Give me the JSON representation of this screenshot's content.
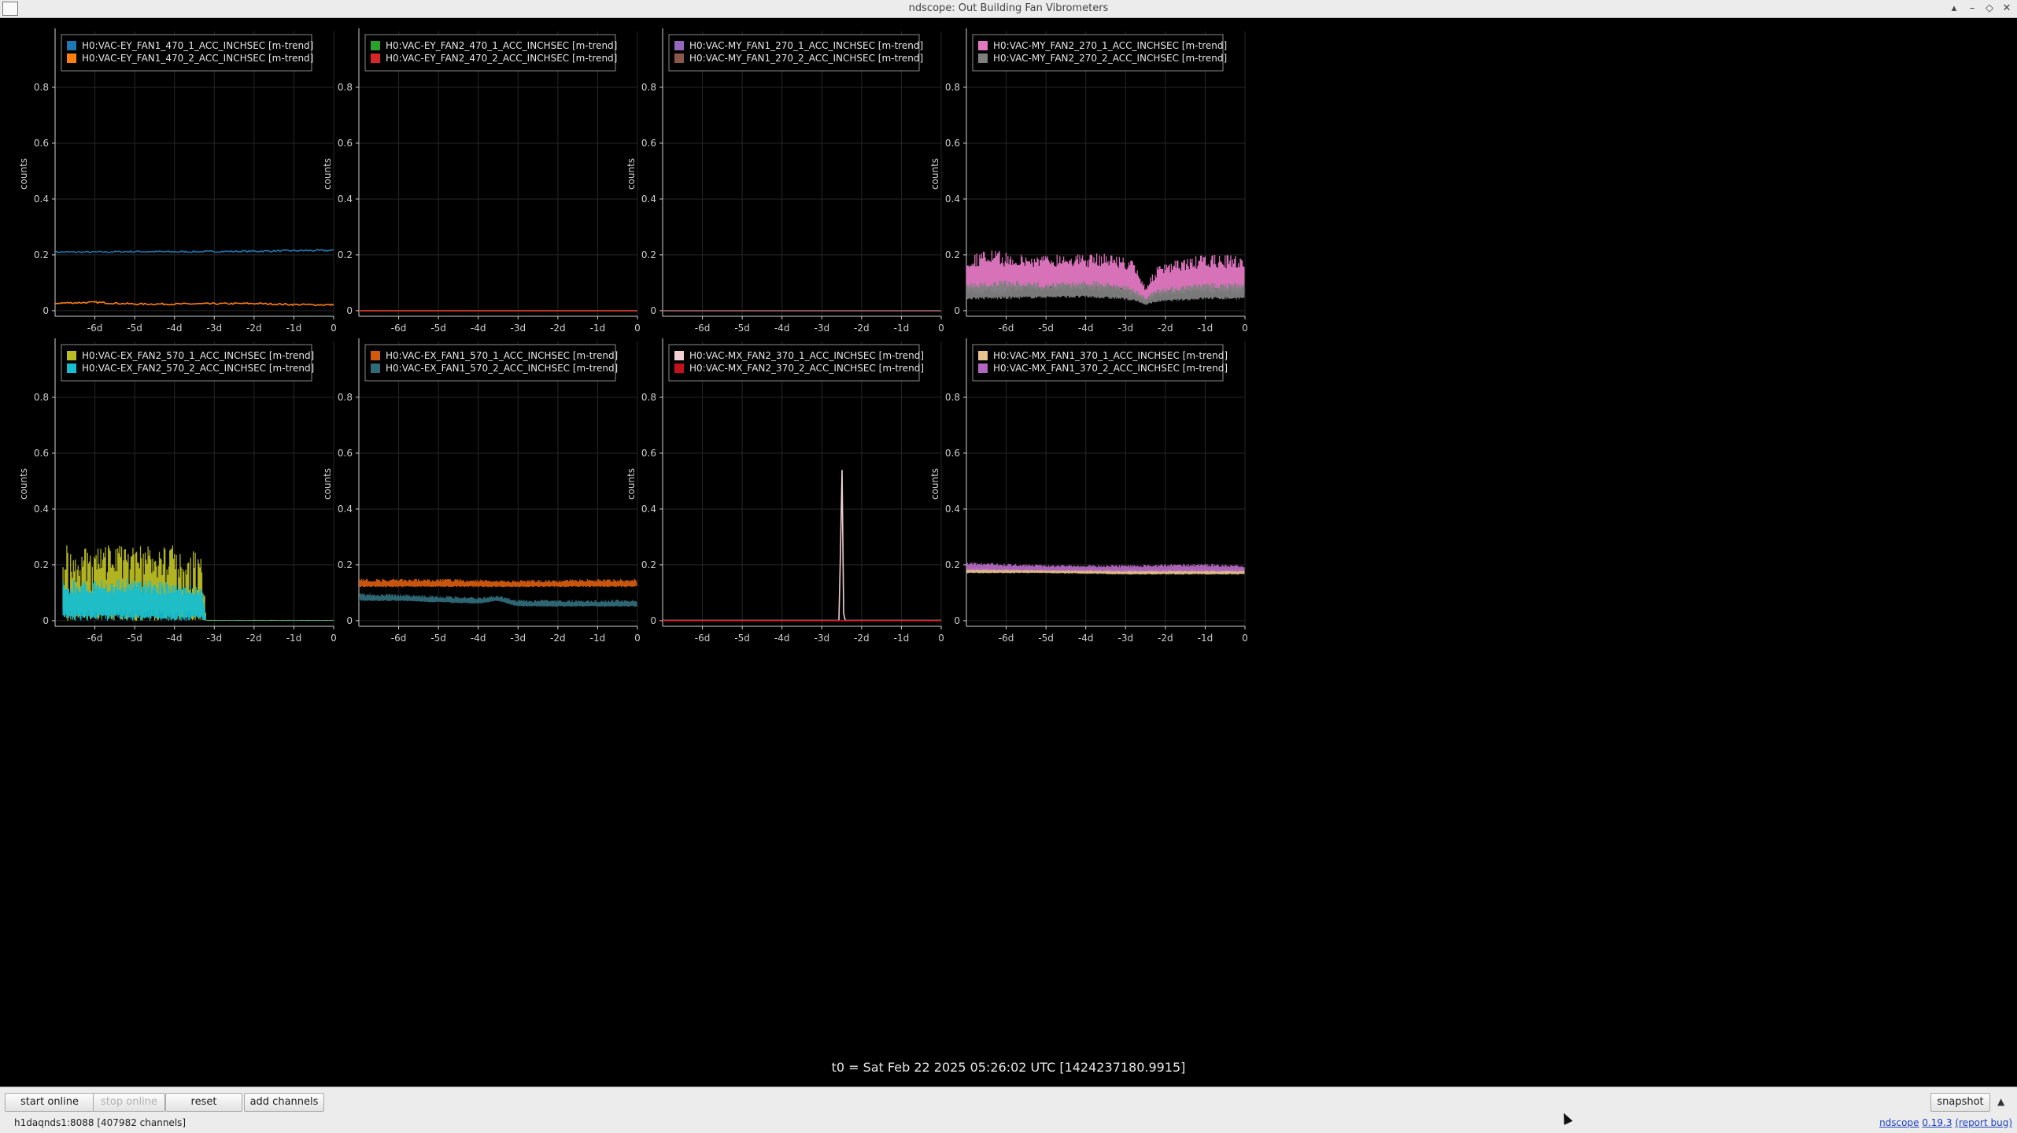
{
  "window": {
    "title": "ndscope: Out Building Fan Vibrometers"
  },
  "colors": {
    "background": "#000000",
    "axis": "#cfcfcf",
    "grid": "#262626",
    "legend_border": "#8a8a8a"
  },
  "plots": [
    {
      "ylabel": "counts",
      "legend": [
        {
          "name": "H0:VAC-EY_FAN1_470_1_ACC_INCHSEC [m-trend]",
          "color": "#1f77b4"
        },
        {
          "name": "H0:VAC-EY_FAN1_470_2_ACC_INCHSEC [m-trend]",
          "color": "#ff7f0e"
        }
      ]
    },
    {
      "ylabel": "counts",
      "legend": [
        {
          "name": "H0:VAC-EY_FAN2_470_1_ACC_INCHSEC [m-trend]",
          "color": "#2ca02c"
        },
        {
          "name": "H0:VAC-EY_FAN2_470_2_ACC_INCHSEC [m-trend]",
          "color": "#d62728"
        }
      ]
    },
    {
      "ylabel": "counts",
      "legend": [
        {
          "name": "H0:VAC-MY_FAN1_270_1_ACC_INCHSEC [m-trend]",
          "color": "#9467bd"
        },
        {
          "name": "H0:VAC-MY_FAN1_270_2_ACC_INCHSEC [m-trend]",
          "color": "#8c564b"
        }
      ]
    },
    {
      "ylabel": "counts",
      "legend": [
        {
          "name": "H0:VAC-MY_FAN2_270_1_ACC_INCHSEC [m-trend]",
          "color": "#e377c2"
        },
        {
          "name": "H0:VAC-MY_FAN2_270_2_ACC_INCHSEC [m-trend]",
          "color": "#7f7f7f"
        }
      ]
    },
    {
      "ylabel": "counts",
      "legend": [
        {
          "name": "H0:VAC-EX_FAN2_570_1_ACC_INCHSEC [m-trend]",
          "color": "#bcbd22"
        },
        {
          "name": "H0:VAC-EX_FAN2_570_2_ACC_INCHSEC [m-trend]",
          "color": "#17becf"
        }
      ]
    },
    {
      "ylabel": "counts",
      "legend": [
        {
          "name": "H0:VAC-EX_FAN1_570_1_ACC_INCHSEC [m-trend]",
          "color": "#d25a0e"
        },
        {
          "name": "H0:VAC-EX_FAN1_570_2_ACC_INCHSEC [m-trend]",
          "color": "#2f6b78"
        }
      ]
    },
    {
      "ylabel": "counts",
      "legend": [
        {
          "name": "H0:VAC-MX_FAN2_370_1_ACC_INCHSEC [m-trend]",
          "color": "#f2d0d4"
        },
        {
          "name": "H0:VAC-MX_FAN2_370_2_ACC_INCHSEC [m-trend]",
          "color": "#c4121a"
        }
      ]
    },
    {
      "ylabel": "counts",
      "legend": [
        {
          "name": "H0:VAC-MX_FAN1_370_1_ACC_INCHSEC [m-trend]",
          "color": "#e8c48c"
        },
        {
          "name": "H0:VAC-MX_FAN1_370_2_ACC_INCHSEC [m-trend]",
          "color": "#b368c0"
        }
      ]
    }
  ],
  "chart_data": [
    {
      "type": "line",
      "ylabel": "counts",
      "xticks": [
        "-6d",
        "-5d",
        "-4d",
        "-3d",
        "-2d",
        "-1d",
        "0"
      ],
      "yticks": [
        "0",
        "0.2",
        "0.4",
        "0.6",
        "0.8"
      ],
      "xlim": [
        -7,
        0
      ],
      "ylim": [
        -0.02,
        1.0
      ],
      "series": [
        {
          "name": "H0:VAC-EY_FAN1_470_1_ACC_INCHSEC [m-trend]",
          "color": "#1f77b4",
          "x": [
            -7,
            -6,
            -5,
            -4,
            -3,
            -2,
            -1,
            0
          ],
          "y": [
            0.21,
            0.21,
            0.212,
            0.211,
            0.212,
            0.213,
            0.215,
            0.216
          ]
        },
        {
          "name": "H0:VAC-EY_FAN1_470_2_ACC_INCHSEC [m-trend]",
          "color": "#ff7f0e",
          "x": [
            -7,
            -6,
            -5,
            -4,
            -3,
            -2,
            -1,
            0
          ],
          "y": [
            0.027,
            0.03,
            0.024,
            0.024,
            0.025,
            0.026,
            0.022,
            0.021
          ]
        }
      ]
    },
    {
      "type": "line",
      "ylabel": "counts",
      "xticks": [
        "-6d",
        "-5d",
        "-4d",
        "-3d",
        "-2d",
        "-1d",
        "0"
      ],
      "yticks": [
        "0",
        "0.2",
        "0.4",
        "0.6",
        "0.8"
      ],
      "xlim": [
        -7,
        0
      ],
      "ylim": [
        -0.02,
        1.0
      ],
      "series": [
        {
          "name": "H0:VAC-EY_FAN2_470_1_ACC_INCHSEC [m-trend]",
          "color": "#2ca02c",
          "x": [
            -7,
            0
          ],
          "y": [
            0,
            0
          ]
        },
        {
          "name": "H0:VAC-EY_FAN2_470_2_ACC_INCHSEC [m-trend]",
          "color": "#d62728",
          "x": [
            -7,
            0
          ],
          "y": [
            0,
            0
          ]
        }
      ]
    },
    {
      "type": "line",
      "ylabel": "counts",
      "xticks": [
        "-6d",
        "-5d",
        "-4d",
        "-3d",
        "-2d",
        "-1d",
        "0"
      ],
      "yticks": [
        "0",
        "0.2",
        "0.4",
        "0.6",
        "0.8"
      ],
      "xlim": [
        -7,
        0
      ],
      "ylim": [
        -0.02,
        1.0
      ],
      "series": [
        {
          "name": "H0:VAC-MY_FAN1_270_1_ACC_INCHSEC [m-trend]",
          "color": "#9467bd",
          "x": [
            -7,
            0
          ],
          "y": [
            0,
            0
          ]
        },
        {
          "name": "H0:VAC-MY_FAN1_270_2_ACC_INCHSEC [m-trend]",
          "color": "#8c564b",
          "x": [
            -7,
            0
          ],
          "y": [
            0,
            0
          ]
        }
      ]
    },
    {
      "type": "area",
      "ylabel": "counts",
      "xticks": [
        "-6d",
        "-5d",
        "-4d",
        "-3d",
        "-2d",
        "-1d",
        "0"
      ],
      "yticks": [
        "0",
        "0.2",
        "0.4",
        "0.6",
        "0.8"
      ],
      "xlim": [
        -7,
        0
      ],
      "ylim": [
        -0.02,
        1.0
      ],
      "series": [
        {
          "name": "H0:VAC-MY_FAN2_270_1_ACC_INCHSEC [m-trend]",
          "color": "#e377c2",
          "x": [
            -7,
            -6.4,
            -6.0,
            -5.5,
            -5,
            -4.5,
            -4,
            -3.5,
            -3.2,
            -2.8,
            -2.5,
            -2.2,
            -1.5,
            -1,
            -0.5,
            0
          ],
          "y_min": [
            0.06,
            0.06,
            0.06,
            0.07,
            0.07,
            0.07,
            0.07,
            0.07,
            0.07,
            0.05,
            0.03,
            0.05,
            0.06,
            0.06,
            0.06,
            0.06
          ],
          "y_max": [
            0.2,
            0.22,
            0.21,
            0.2,
            0.2,
            0.21,
            0.2,
            0.21,
            0.2,
            0.18,
            0.09,
            0.16,
            0.19,
            0.2,
            0.2,
            0.2
          ]
        },
        {
          "name": "H0:VAC-MY_FAN2_270_2_ACC_INCHSEC [m-trend]",
          "color": "#7f7f7f",
          "x": [
            -7,
            -6.0,
            -5,
            -4,
            -3.2,
            -2.8,
            -2.5,
            -2.2,
            -1,
            0
          ],
          "y_min": [
            0.04,
            0.04,
            0.045,
            0.045,
            0.04,
            0.035,
            0.02,
            0.03,
            0.04,
            0.04
          ],
          "y_max": [
            0.1,
            0.11,
            0.1,
            0.11,
            0.1,
            0.08,
            0.05,
            0.08,
            0.1,
            0.1
          ]
        }
      ]
    },
    {
      "type": "area",
      "ylabel": "counts",
      "xticks": [
        "-6d",
        "-5d",
        "-4d",
        "-3d",
        "-2d",
        "-1d",
        "0"
      ],
      "yticks": [
        "0",
        "0.2",
        "0.4",
        "0.6",
        "0.8"
      ],
      "xlim": [
        -7,
        0
      ],
      "ylim": [
        -0.02,
        1.0
      ],
      "series": [
        {
          "name": "H0:VAC-EX_FAN2_570_1_ACC_INCHSEC [m-trend]",
          "color": "#bcbd22",
          "x": [
            -6.8,
            -6.0,
            -5.0,
            -4.0,
            -3.3,
            -3.2,
            0
          ],
          "y_min": [
            0,
            0,
            0,
            0,
            0,
            0,
            0
          ],
          "y_max": [
            0.28,
            0.27,
            0.27,
            0.27,
            0.26,
            0.003,
            0.003
          ]
        },
        {
          "name": "H0:VAC-EX_FAN2_570_2_ACC_INCHSEC [m-trend]",
          "color": "#17becf",
          "x": [
            -6.8,
            -6.0,
            -5.0,
            -4.0,
            -3.3,
            -3.2,
            0
          ],
          "y_min": [
            0,
            0,
            0,
            0,
            0,
            0,
            0
          ],
          "y_max": [
            0.15,
            0.15,
            0.15,
            0.14,
            0.12,
            0.002,
            0.002
          ]
        }
      ]
    },
    {
      "type": "area",
      "ylabel": "counts",
      "xticks": [
        "-6d",
        "-5d",
        "-4d",
        "-3d",
        "-2d",
        "-1d",
        "0"
      ],
      "yticks": [
        "0",
        "0.2",
        "0.4",
        "0.6",
        "0.8"
      ],
      "xlim": [
        -7,
        0
      ],
      "ylim": [
        -0.02,
        1.0
      ],
      "series": [
        {
          "name": "H0:VAC-EX_FAN1_570_1_ACC_INCHSEC [m-trend]",
          "color": "#d25a0e",
          "x": [
            -7,
            -5,
            -3,
            -1,
            0
          ],
          "y_min": [
            0.12,
            0.12,
            0.12,
            0.12,
            0.12
          ],
          "y_max": [
            0.15,
            0.15,
            0.145,
            0.15,
            0.15
          ]
        },
        {
          "name": "H0:VAC-EX_FAN1_570_2_ACC_INCHSEC [m-trend]",
          "color": "#2f6b78",
          "x": [
            -7,
            -6,
            -5,
            -4,
            -3.5,
            -3,
            -2,
            -1,
            0
          ],
          "y_min": [
            0.07,
            0.07,
            0.065,
            0.06,
            0.07,
            0.05,
            0.05,
            0.05,
            0.05
          ],
          "y_max": [
            0.1,
            0.095,
            0.09,
            0.085,
            0.09,
            0.075,
            0.075,
            0.075,
            0.075
          ]
        }
      ]
    },
    {
      "type": "line",
      "ylabel": "counts",
      "xticks": [
        "-6d",
        "-5d",
        "-4d",
        "-3d",
        "-2d",
        "-1d",
        "0"
      ],
      "yticks": [
        "0",
        "0.2",
        "0.4",
        "0.6",
        "0.8"
      ],
      "xlim": [
        -7,
        0
      ],
      "ylim": [
        -0.02,
        1.0
      ],
      "series": [
        {
          "name": "H0:VAC-MX_FAN2_370_1_ACC_INCHSEC [m-trend]",
          "color": "#f2d0d4",
          "x": [
            -7,
            -2.55,
            -2.5,
            -2.45,
            0
          ],
          "y": [
            0.001,
            0.001,
            0.65,
            0.001,
            0.001
          ]
        },
        {
          "name": "H0:VAC-MX_FAN2_370_2_ACC_INCHSEC [m-trend]",
          "color": "#c4121a",
          "x": [
            -7,
            0
          ],
          "y": [
            0,
            0
          ]
        }
      ]
    },
    {
      "type": "area",
      "ylabel": "counts",
      "xticks": [
        "-6d",
        "-5d",
        "-4d",
        "-3d",
        "-2d",
        "-1d",
        "0"
      ],
      "yticks": [
        "0",
        "0.2",
        "0.4",
        "0.6",
        "0.8"
      ],
      "xlim": [
        -7,
        0
      ],
      "ylim": [
        -0.02,
        1.0
      ],
      "series": [
        {
          "name": "H0:VAC-MX_FAN1_370_1_ACC_INCHSEC [m-trend]",
          "color": "#e8c48c",
          "x": [
            -7,
            -5,
            -3,
            -1,
            0
          ],
          "y_min": [
            0.17,
            0.17,
            0.165,
            0.165,
            0.165
          ],
          "y_max": [
            0.19,
            0.185,
            0.185,
            0.185,
            0.185
          ]
        },
        {
          "name": "H0:VAC-MX_FAN1_370_2_ACC_INCHSEC [m-trend]",
          "color": "#b368c0",
          "x": [
            -7,
            -5,
            -3,
            -1,
            0
          ],
          "y_min": [
            0.18,
            0.178,
            0.175,
            0.175,
            0.175
          ],
          "y_max": [
            0.21,
            0.2,
            0.2,
            0.205,
            0.2
          ]
        }
      ]
    }
  ],
  "time_origin": {
    "label": "t0 = Sat Feb 22 2025 05:26:02 UTC [1424237180.9915]"
  },
  "toolbar": {
    "start_online": "start online",
    "stop_online": "stop online",
    "reset": "reset",
    "add_channels": "add channels",
    "snapshot": "snapshot",
    "expand_glyph": "▲"
  },
  "status": {
    "server": "h1daqnds1:8088",
    "channels": "[407982 channels]",
    "app_name": "ndscope",
    "version": "0.19.3",
    "report_bug": "(report bug)"
  }
}
